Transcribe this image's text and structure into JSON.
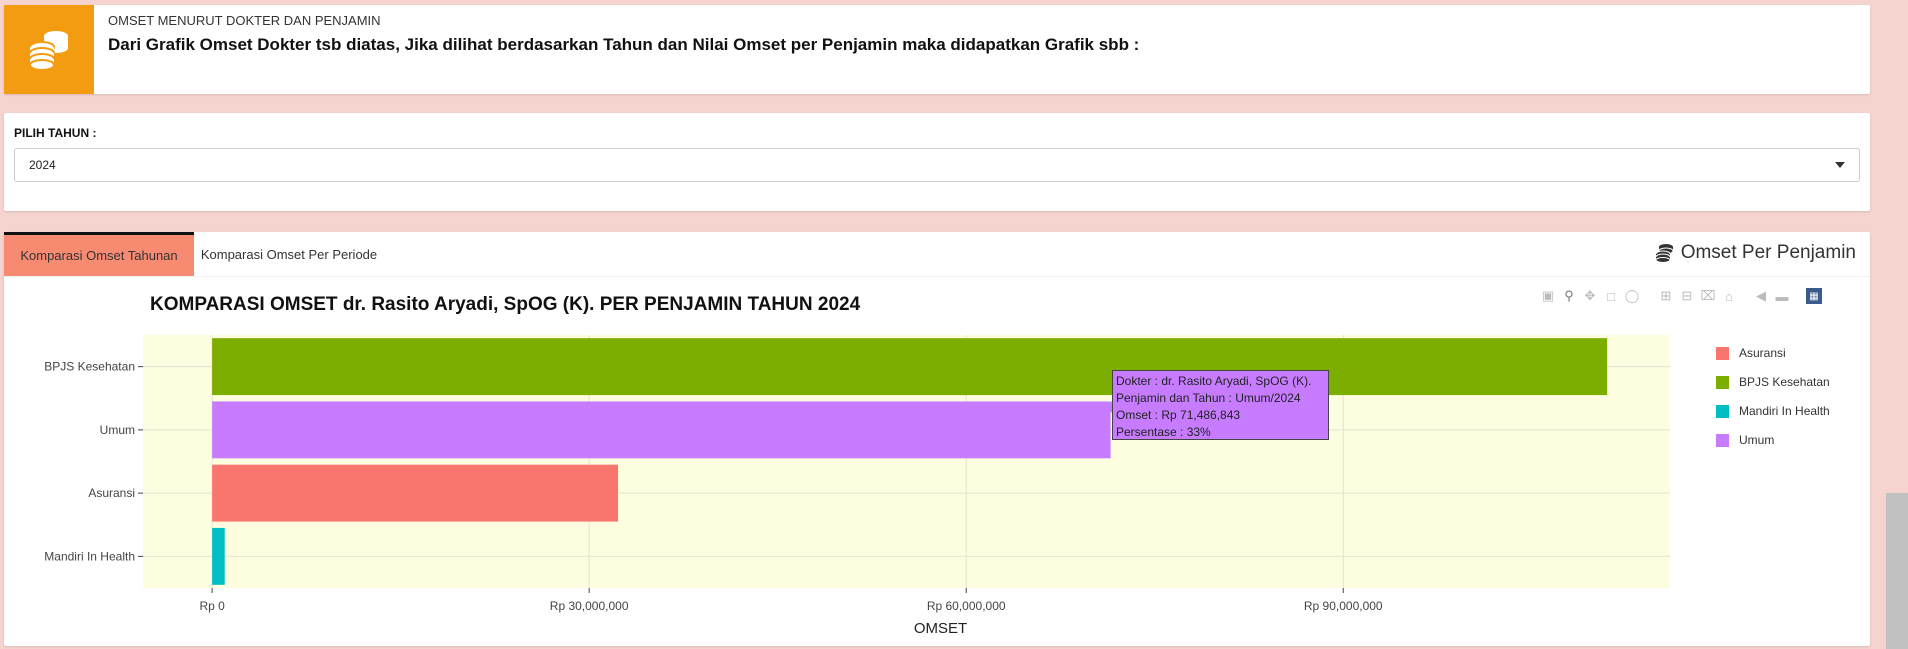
{
  "info": {
    "label": "OMSET MENURUT DOKTER DAN PENJAMIN",
    "text": "Dari Grafik Omset Dokter tsb diatas, Jika dilihat berdasarkan Tahun dan Nilai Omset per Penjamin maka didapatkan Grafik sbb :",
    "icon": "coins-icon",
    "accent": "#f39c12"
  },
  "year_filter": {
    "label": "PILIH TAHUN :",
    "value": "2024"
  },
  "tabs": [
    {
      "label": "Komparasi Omset Tahunan",
      "active": true
    },
    {
      "label": "Komparasi Omset Per Periode",
      "active": false
    }
  ],
  "box_title": "Omset Per Penjamin",
  "chart_data": {
    "type": "bar",
    "orientation": "horizontal",
    "title": "KOMPARASI OMSET dr. Rasito Aryadi, SpOG (K). PER PENJAMIN TAHUN 2024",
    "xlabel": "OMSET",
    "ylabel": "",
    "categories": [
      "BPJS Kesehatan",
      "Umum",
      "Asuransi",
      "Mandiri In Health"
    ],
    "values": [
      111000000,
      71486843,
      32300000,
      1000000
    ],
    "colors": [
      "#7cae00",
      "#c77cff",
      "#f8766d",
      "#00bfc4"
    ],
    "xlim": [
      -5500000,
      116000000
    ],
    "xticks": [
      0,
      30000000,
      60000000,
      90000000
    ],
    "xtick_labels": [
      "Rp 0",
      "Rp 30,000,000",
      "Rp 60,000,000",
      "Rp 90,000,000"
    ],
    "plot_background": "#fdfde0",
    "grid": true,
    "legend": {
      "position": "right",
      "items": [
        {
          "name": "Asuransi",
          "color": "#f8766d"
        },
        {
          "name": "BPJS Kesehatan",
          "color": "#7cae00"
        },
        {
          "name": "Mandiri In Health",
          "color": "#00bfc4"
        },
        {
          "name": "Umum",
          "color": "#c77cff"
        }
      ]
    },
    "tooltip": {
      "lines": [
        "Dokter : dr. Rasito Aryadi, SpOG (K).",
        "Penjamin dan Tahun : Umum/2024",
        "Omset : Rp 71,486,843",
        "Persentase : 33%"
      ]
    }
  }
}
